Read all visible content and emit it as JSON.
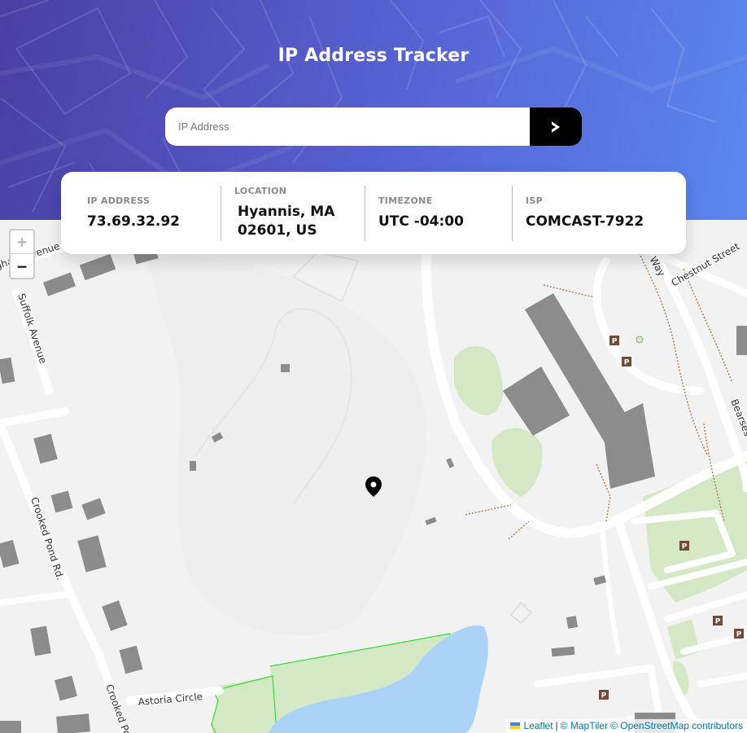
{
  "app": {
    "title": "IP Address Tracker"
  },
  "search": {
    "placeholder": "IP Address",
    "value": ""
  },
  "info": {
    "ip_label": "IP ADDRESS",
    "ip_value": "73.69.32.92",
    "location_label": "LOCATION",
    "location_value": "Hyannis, MA 02601, US",
    "timezone_label": "TIMEZONE",
    "timezone_value": "UTC -04:00",
    "isp_label": "ISP",
    "isp_value": "COMCAST-7922"
  },
  "map": {
    "zoom_in": "+",
    "zoom_out": "−",
    "street_labels": [
      "Suffolk Avenue",
      "Crooked Pond Rd.",
      "Astoria Circle",
      "Chestnut Street",
      "Way",
      "Brigham Avenue",
      "Bearses",
      "Crooked Po"
    ],
    "parking_symbol": "P",
    "attribution": {
      "leaflet": "Leaflet",
      "separator": "|",
      "maptiler": "© MapTiler",
      "osm": "© OpenStreetMap contributors"
    }
  },
  "colors": {
    "hero_start": "#4a3fa3",
    "hero_end": "#5b86ee",
    "map_background": "#f2f2f2",
    "park": "#d4e8c6",
    "water": "#aad3f7",
    "building": "#8c8c8c",
    "link": "#0078a8"
  }
}
